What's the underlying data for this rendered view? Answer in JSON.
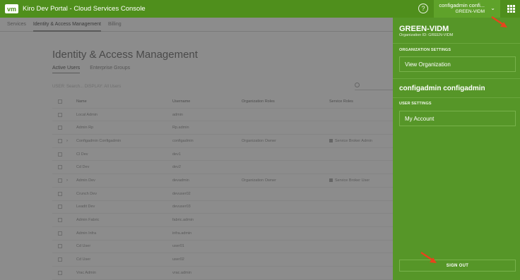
{
  "header": {
    "logo_text": "vm",
    "title": "Kiro Dev Portal - Cloud Services Console",
    "help_icon": "question-circle-icon",
    "user_button": {
      "name": "configadmin confi...",
      "org": "GREEN-VIDM"
    },
    "apps_icon": "grid-icon"
  },
  "page": {
    "top_tabs": [
      "Services",
      "Identity & Access Management",
      "Billing"
    ],
    "title": "Identity & Access Management",
    "sub_tabs": [
      "Active Users",
      "Enterprise Groups"
    ],
    "search_hint": "USER: Search...     DISPLAY: All Users",
    "table": {
      "columns": [
        "Name",
        "Username",
        "Organization Roles",
        "Service Roles"
      ],
      "rows": [
        {
          "name": "Local Admin",
          "username": "admin",
          "role": "",
          "service": ""
        },
        {
          "name": "Admin Rp",
          "username": "Rp.admin",
          "role": "",
          "service": ""
        },
        {
          "name": "Configadmin Configadmin",
          "username": "configadmin",
          "role": "Organization Owner",
          "service": "Service Broker Admin"
        },
        {
          "name": "Cl Dev",
          "username": "dev1",
          "role": "",
          "service": ""
        },
        {
          "name": "Cd Dev",
          "username": "dev2",
          "role": "",
          "service": ""
        },
        {
          "name": "Admin Dev",
          "username": "devadmin",
          "role": "Organization Owner",
          "service": "Service Broker User"
        },
        {
          "name": "Crunch Dev",
          "username": "devuser02",
          "role": "",
          "service": ""
        },
        {
          "name": "Leadit Dev",
          "username": "devuser03",
          "role": "",
          "service": ""
        },
        {
          "name": "Admin Fabric",
          "username": "fabric.admin",
          "role": "",
          "service": ""
        },
        {
          "name": "Admin Infra",
          "username": "infra.admin",
          "role": "",
          "service": ""
        },
        {
          "name": "Cd User",
          "username": "user01",
          "role": "",
          "service": ""
        },
        {
          "name": "Cd User",
          "username": "user02",
          "role": "",
          "service": ""
        },
        {
          "name": "Vrac Admin",
          "username": "vrac.admin",
          "role": "",
          "service": ""
        }
      ]
    }
  },
  "drawer": {
    "org_name": "GREEN-VIDM",
    "org_id": "Organization ID: GREEN-VIDM",
    "org_settings_label": "ORGANIZATION SETTINGS",
    "view_org_button": "View Organization",
    "user_full_name": "configadmin configadmin",
    "user_settings_label": "USER SETTINGS",
    "my_account_button": "My Account",
    "sign_out_button": "SIGN OUT"
  },
  "colors": {
    "header_green": "#4f8f1c",
    "drawer_green": "#569628",
    "annotation_arrow": "#e8431c"
  }
}
